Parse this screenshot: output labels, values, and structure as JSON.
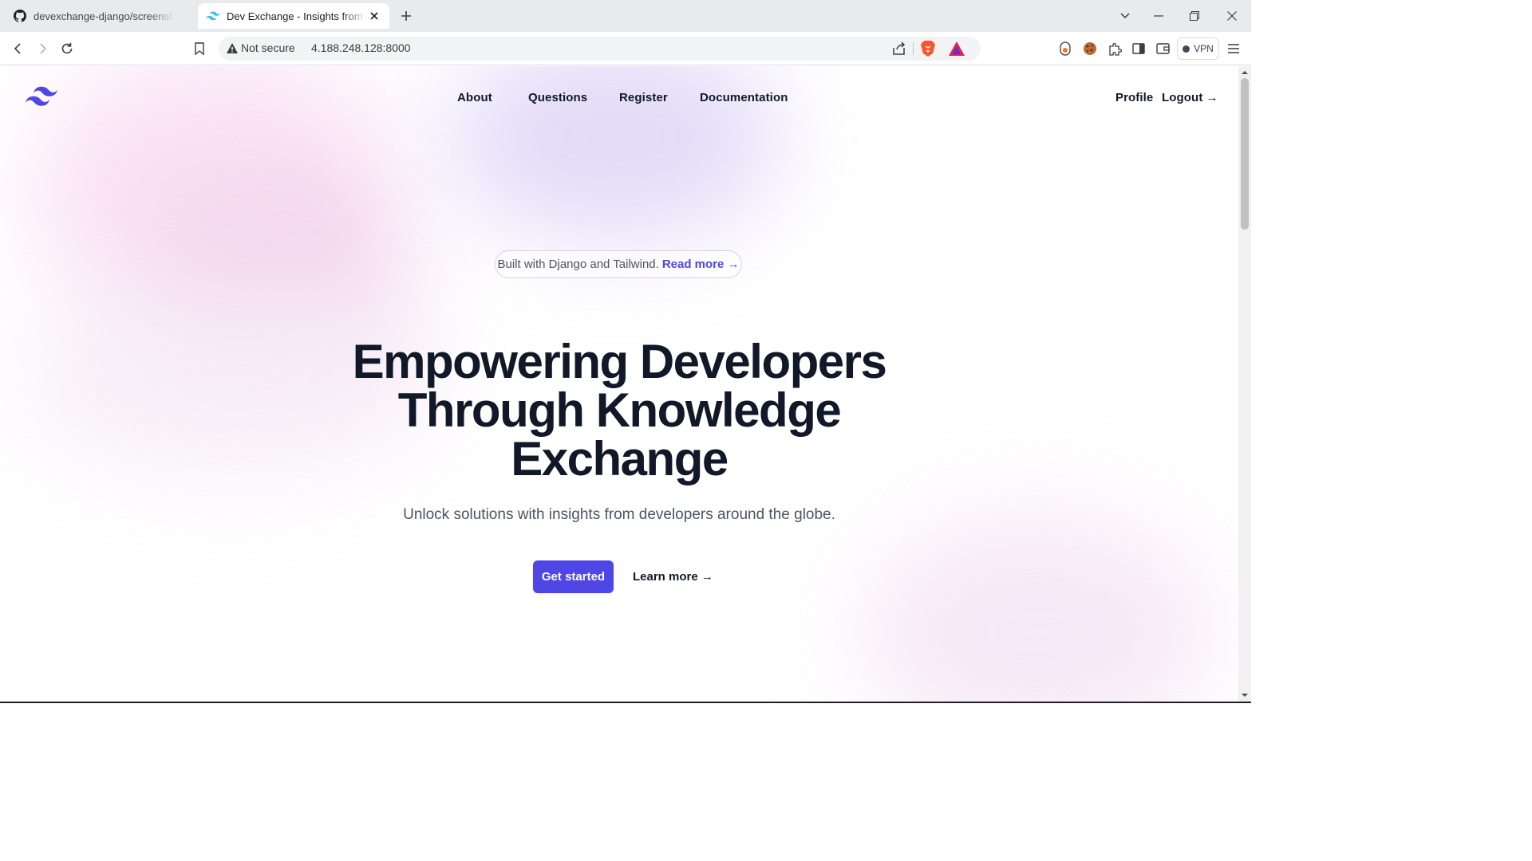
{
  "browser": {
    "tabs": [
      {
        "title": "devexchange-django/screenshots a",
        "icon": "github-icon",
        "active": false
      },
      {
        "title": "Dev Exchange - Insights from d",
        "icon": "tailwind-icon",
        "active": true
      }
    ],
    "omnibox": {
      "security_label": "Not secure",
      "url": "4.188.248.128:8000"
    },
    "vpn_label": "VPN"
  },
  "page": {
    "nav": {
      "about": "About",
      "questions": "Questions",
      "register": "Register",
      "documentation": "Documentation",
      "profile": "Profile",
      "logout": "Logout →"
    },
    "announcement": {
      "text": "Built with Django and Tailwind.",
      "link": "Read more →"
    },
    "hero": {
      "line1": "Empowering Developers",
      "line2": "Through Knowledge",
      "line3": "Exchange",
      "subtitle": "Unlock solutions with insights from developers around the globe.",
      "cta_primary": "Get started",
      "cta_secondary": "Learn more →"
    }
  },
  "colors": {
    "accent": "#4f46e5",
    "heading": "#111827",
    "body_text": "#4b5563",
    "logo": "#4f46e5"
  }
}
